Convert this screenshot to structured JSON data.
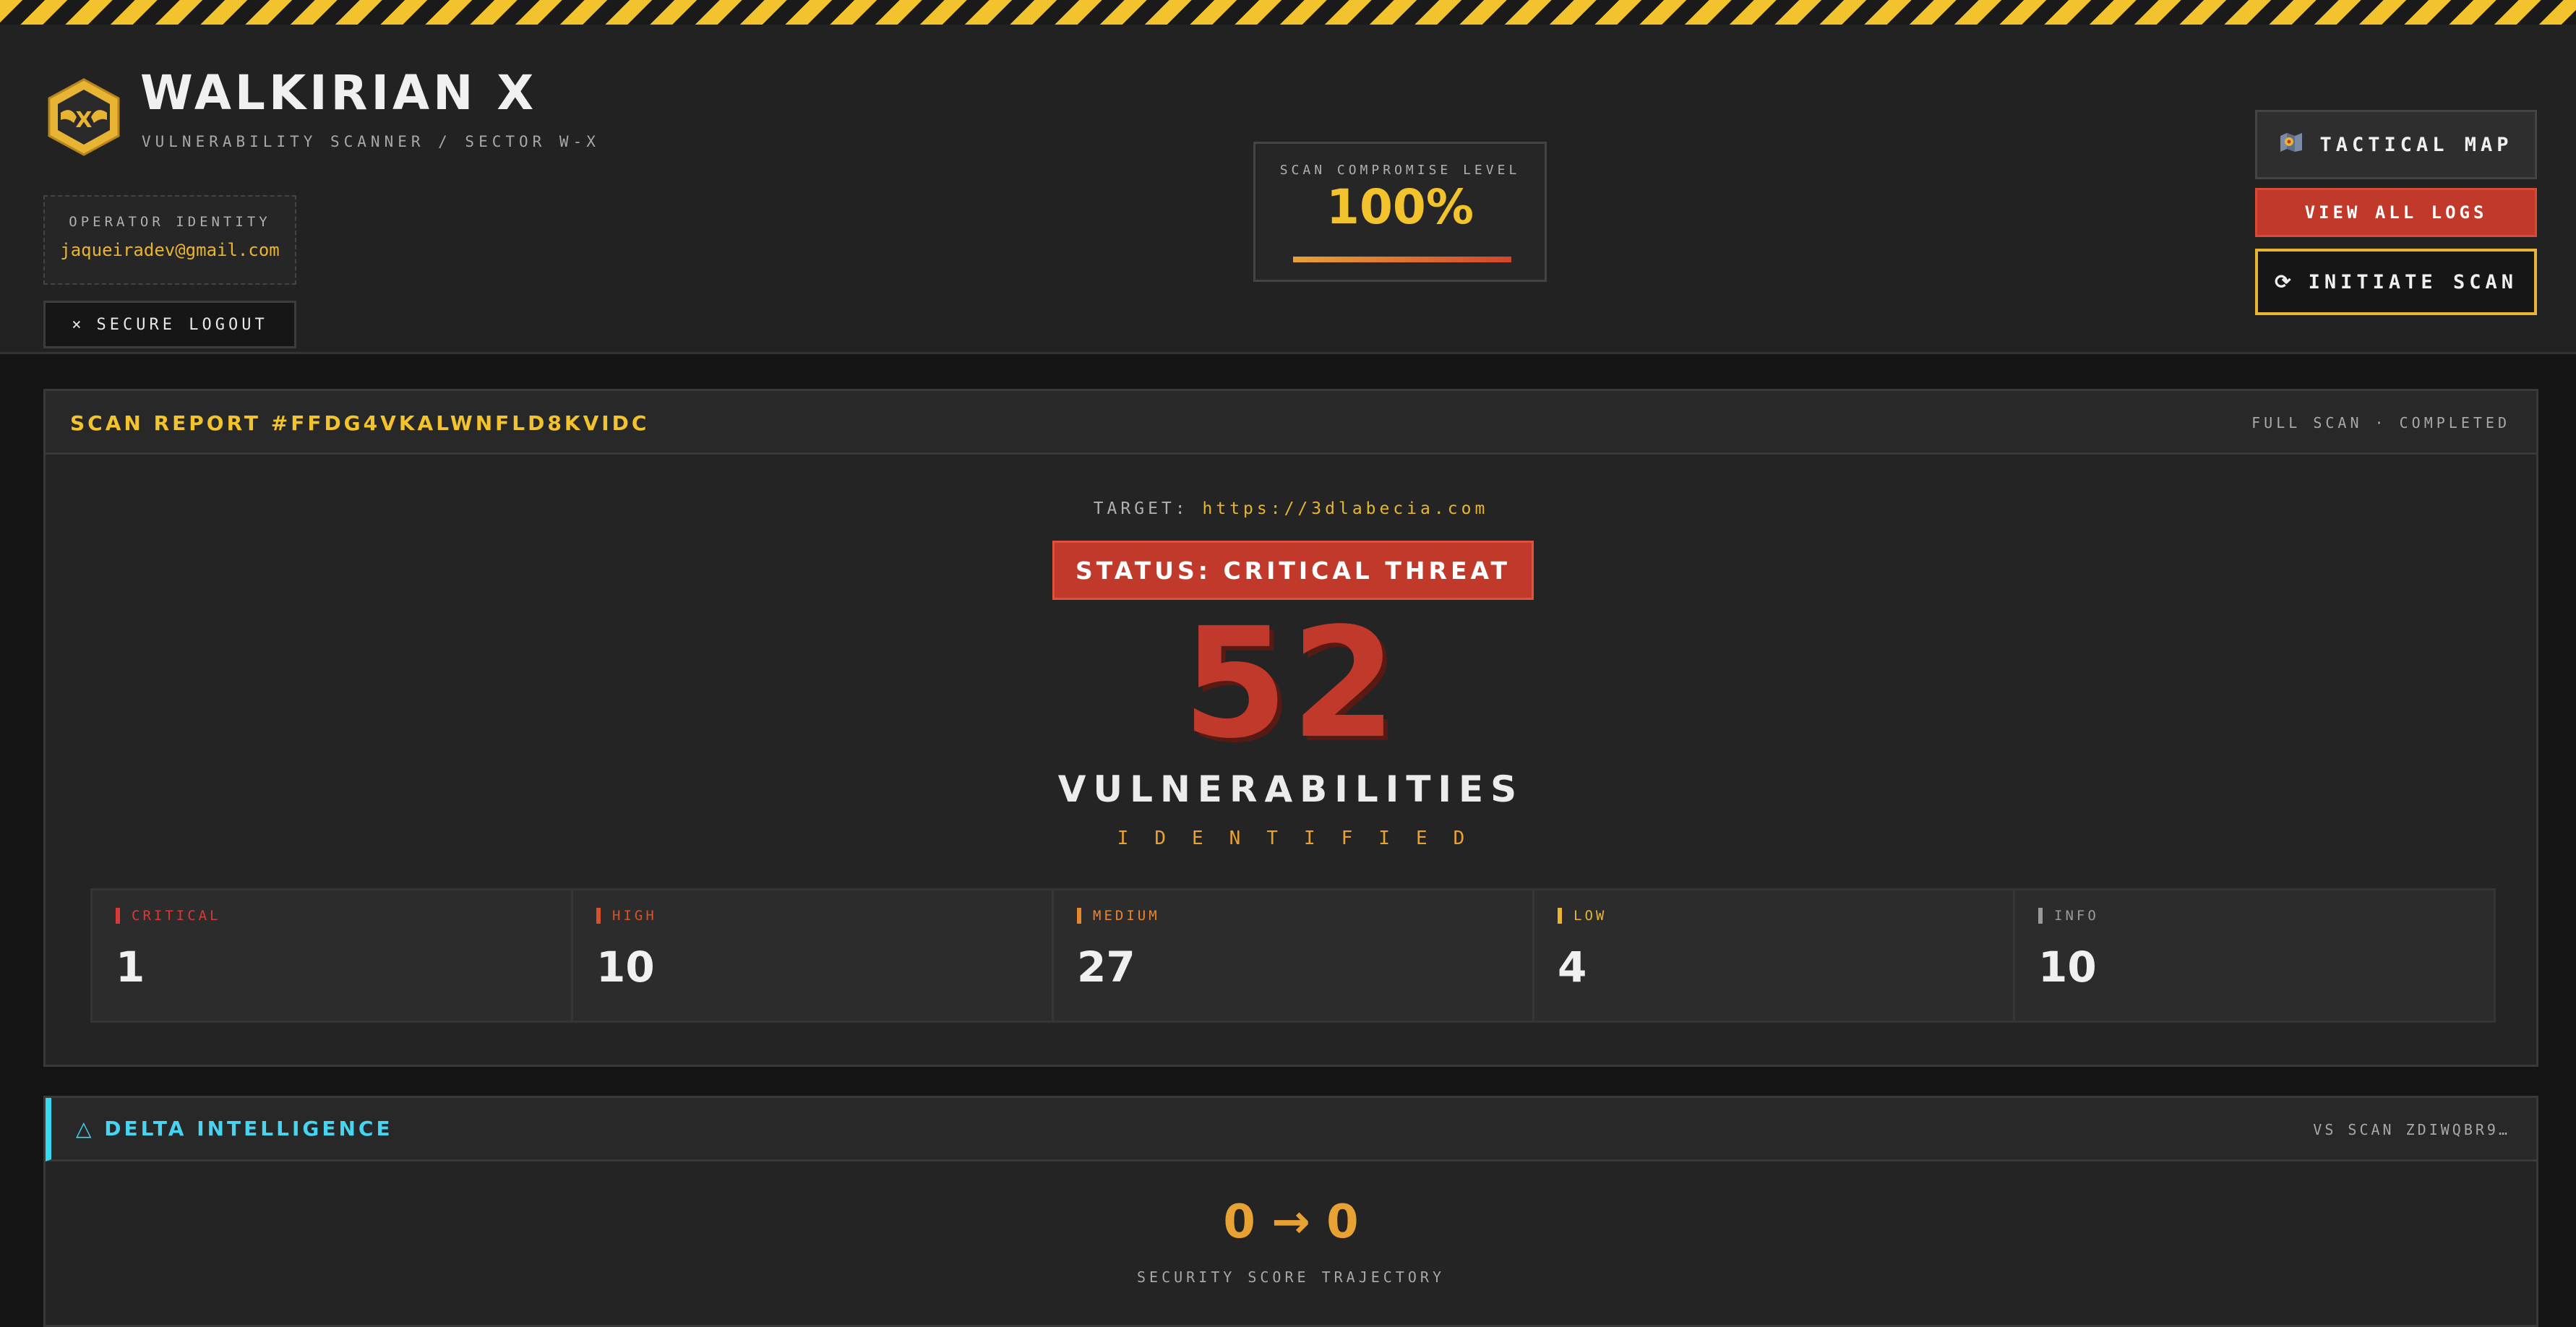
{
  "header": {
    "title": "WALKIRIAN X",
    "subtitle": "VULNERABILITY SCANNER / SECTOR W-X",
    "operator_label": "OPERATOR IDENTITY",
    "operator_email": "jaqueiradev@gmail.com",
    "logout_icon": "×",
    "logout_label": "SECURE LOGOUT",
    "compromise_label": "SCAN COMPROMISE LEVEL",
    "compromise_value": "100%",
    "compromise_fraction": 1.0,
    "tactical_icon": "map-icon",
    "tactical_label": "TACTICAL MAP",
    "logs_label": "VIEW ALL LOGS",
    "scan_icon": "⟳",
    "scan_label": "INITIATE SCAN"
  },
  "report": {
    "title": "SCAN REPORT #FFDG4VKALWNFLD8KVIDC",
    "meta": "FULL SCAN · COMPLETED",
    "target_label": "TARGET:",
    "target_url": "https://3dlabecia.com",
    "status": "STATUS: CRITICAL THREAT",
    "count": "52",
    "count_label": "VULNERABILITIES",
    "count_sub": "IDENTIFIED",
    "severities": [
      {
        "name": "CRITICAL",
        "count": "1",
        "color": "#d83a3a"
      },
      {
        "name": "HIGH",
        "count": "10",
        "color": "#d8532c"
      },
      {
        "name": "MEDIUM",
        "count": "27",
        "color": "#e8862c"
      },
      {
        "name": "LOW",
        "count": "4",
        "color": "#e8b434"
      },
      {
        "name": "INFO",
        "count": "10",
        "color": "#9a9a9a"
      }
    ]
  },
  "delta": {
    "title": "△ DELTA INTELLIGENCE",
    "meta": "VS SCAN ZDIWQBR9…",
    "trend": "0 → 0",
    "trend_label": "SECURITY SCORE TRAJECTORY"
  },
  "colors": {
    "accent_yellow": "#f2c32c",
    "danger_red": "#c0392b",
    "cyan": "#38d8f0"
  }
}
